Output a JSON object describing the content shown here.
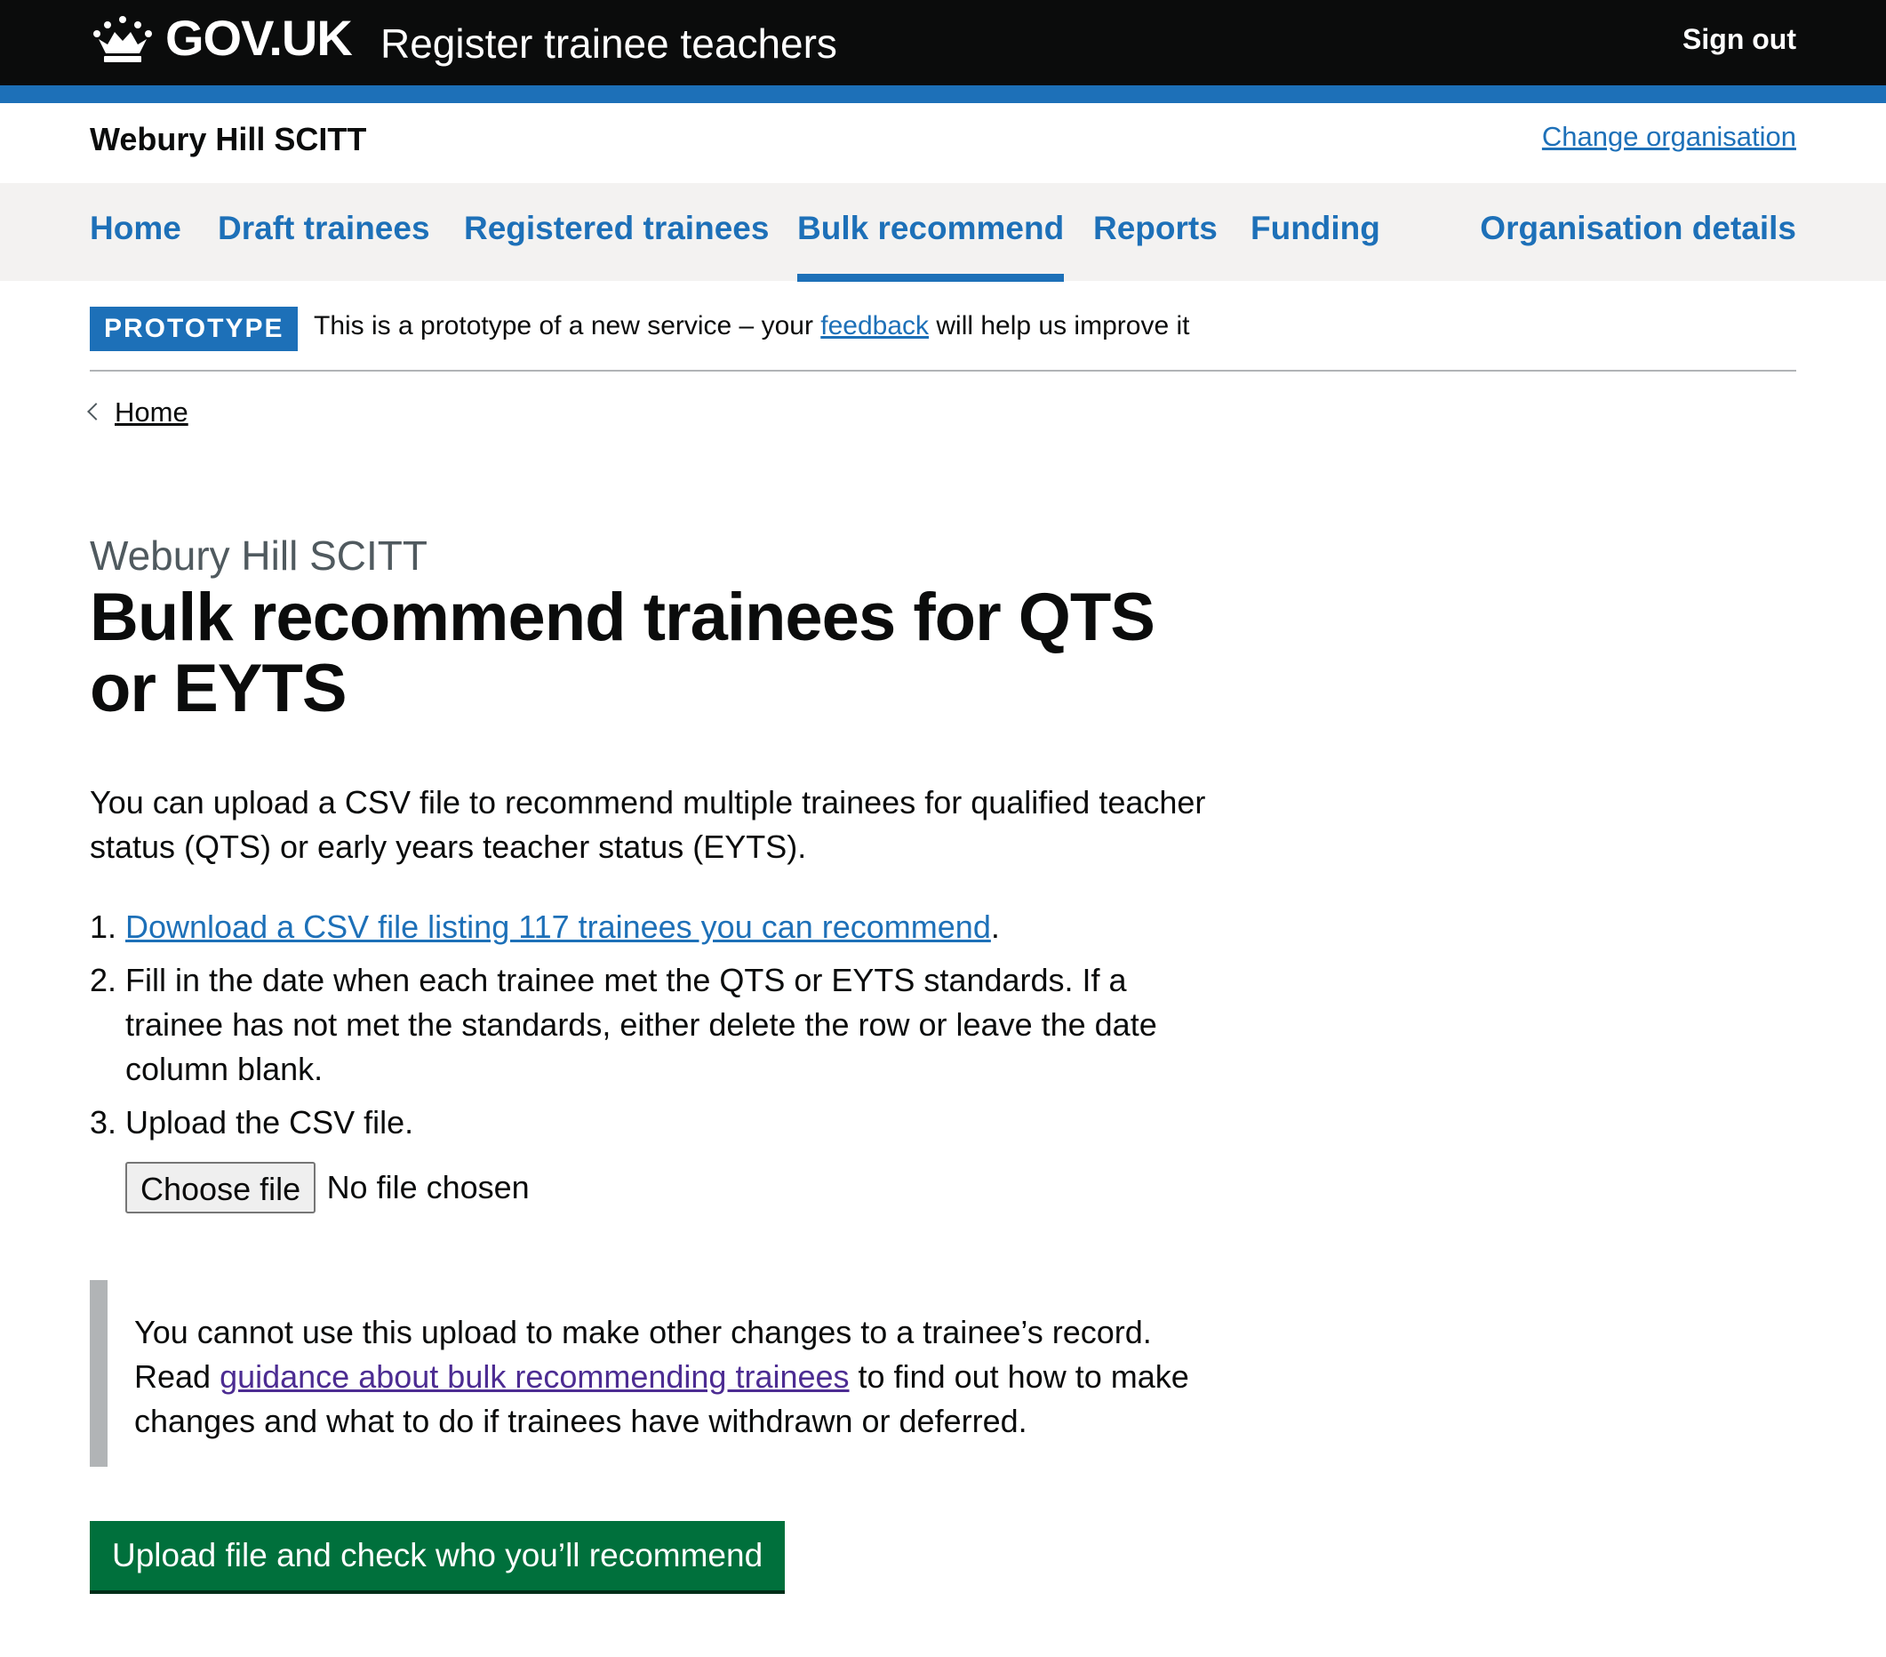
{
  "header": {
    "logo_text": "GOV.UK",
    "service_name": "Register trainee teachers",
    "sign_out_label": "Sign out"
  },
  "org_bar": {
    "name": "Webury Hill SCITT",
    "change_label": "Change organisation"
  },
  "nav": {
    "items": [
      {
        "label": "Home"
      },
      {
        "label": "Draft trainees"
      },
      {
        "label": "Registered trainees"
      },
      {
        "label": "Bulk recommend"
      },
      {
        "label": "Reports"
      },
      {
        "label": "Funding"
      },
      {
        "label": "Organisation details"
      }
    ],
    "current": "Bulk recommend"
  },
  "phase_banner": {
    "tag": "PROTOTYPE",
    "text_before": "This is a prototype of a new service – your ",
    "link": "feedback",
    "text_after": " will help us improve it"
  },
  "breadcrumb": {
    "label": "Home"
  },
  "main": {
    "caption": "Webury Hill SCITT",
    "title": "Bulk recommend trainees for QTS or EYTS",
    "intro": "You can upload a CSV file to recommend multiple trainees for qualified teacher status (QTS) or early years teacher status (EYTS).",
    "steps": [
      {
        "num": "1.",
        "link": "Download a CSV file listing 117 trainees you can recommend",
        "after": "."
      },
      {
        "num": "2.",
        "text": "Fill in the date when each trainee met the QTS or EYTS standards. If a trainee has not met the standards, either delete the row or leave the date column blank."
      },
      {
        "num": "3.",
        "text": "Upload the CSV file."
      }
    ],
    "file_input": {
      "button_label": "Choose file",
      "status": "No file chosen"
    },
    "inset": {
      "text_before": "You cannot use this upload to make other changes to a trainee’s record. Read ",
      "link": "guidance about bulk recommending trainees",
      "text_after": " to find out how to make changes and what to do if trainees have withdrawn or deferred."
    },
    "submit_label": "Upload file and check who you’ll recommend"
  },
  "colors": {
    "header_bg": "#0b0c0c",
    "brand_blue": "#1d70b8",
    "nav_bg": "#f3f2f1",
    "button_green": "#00703c",
    "visited_link": "#4c2c92",
    "inset_border": "#b1b4b6"
  }
}
